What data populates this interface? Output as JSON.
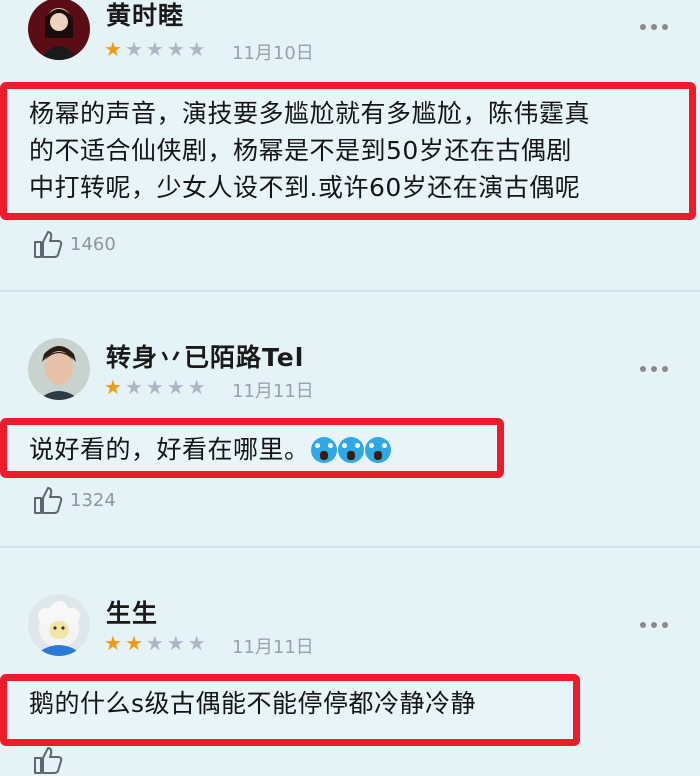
{
  "reviews": [
    {
      "user": "黄时睦",
      "date": "11月10日",
      "rating": 1,
      "text_lines": [
        "杨幂的声音，演技要多尴尬就有多尴尬，陈伟霆真",
        "的不适合仙侠剧，杨幂是不是到50岁还在古偶剧",
        "中打转呢，少女人设不到.或许60岁还在演古偶呢"
      ],
      "likes": "1460"
    },
    {
      "user": "转身丷已陌路Tel",
      "date": "11月11日",
      "rating": 1,
      "text_lines": [
        "说好看的，好看在哪里。"
      ],
      "likes": "1324"
    },
    {
      "user": "生生",
      "date": "11月11日",
      "rating": 2,
      "text_lines": [
        "鹅的什么s级古偶能不能停停都冷静冷静"
      ],
      "likes": ""
    }
  ],
  "stars_max": 5,
  "icons": {
    "like": "thumbs-up-icon",
    "more": "more-dots-icon",
    "scream_emoji": "face-screaming-in-fear-icon"
  },
  "colors": {
    "highlight_box": "#ec1c2a",
    "star_filled": "#f29a12",
    "star_empty": "#aeb6c4"
  }
}
